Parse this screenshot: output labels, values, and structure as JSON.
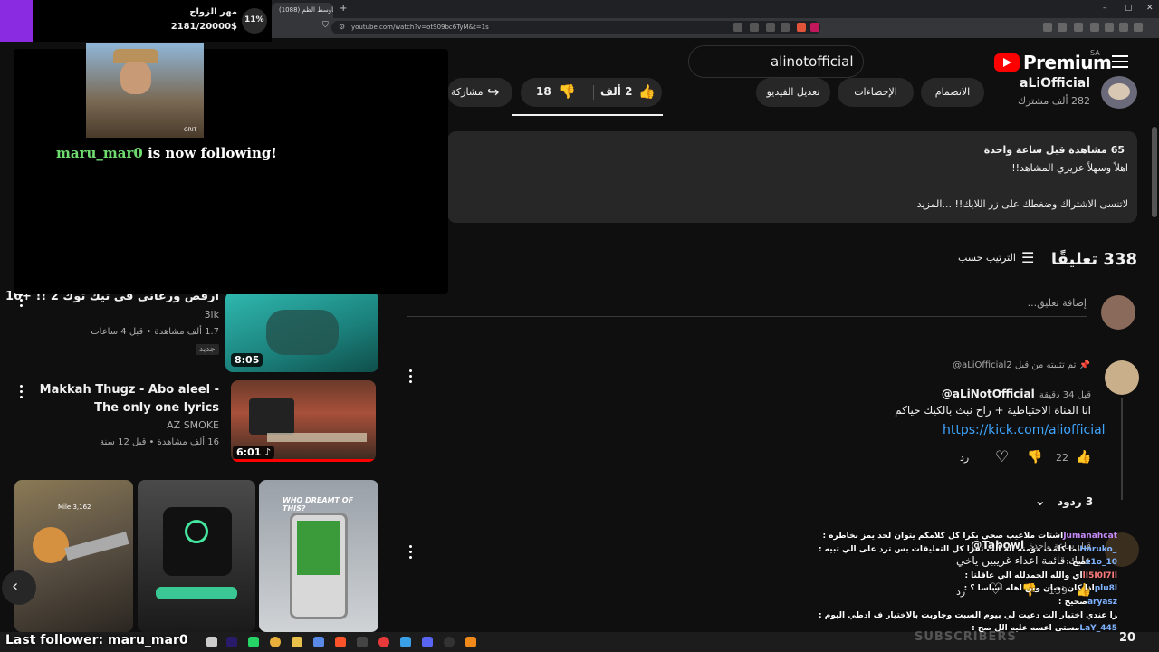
{
  "browser": {
    "tab_title": "(1088) ماوسط الظم...",
    "new_tab_label": "+",
    "url": "youtube.com/watch?v=otS09bc6TyM&t=1s"
  },
  "header": {
    "search_value": "alinotofficial",
    "logo_text": "Premium",
    "region": "SA"
  },
  "channel": {
    "name": "aLiOfficial",
    "subscribers": "282 ألف مشترك",
    "join_label": "الانضمام",
    "stats_label": "الإحصاءات",
    "edit_label": "تعديل الفيديو",
    "like_count": "2 ألف",
    "dislike_count": "18",
    "share_label": "مشاركة"
  },
  "description": {
    "views_time": "65 مشاهدة  قبل ساعة واحدة",
    "line1": "اهلاً وسهلاً عزيزي المشاهد!!",
    "line2": "لاتنسى الاشتراك وضغطك على زر اللايك!! ...المزيد"
  },
  "comments": {
    "count_label": "338 تعليقًا",
    "sort_label": "الترتيب حسب",
    "add_placeholder": "إضافة تعليق...",
    "pinned_by": "تم تثبيته من قبل ‎@aLiOfficial2",
    "items": [
      {
        "author": "@aLiNotOfficial",
        "time": "قبل 34 دقيقة",
        "text": "انا القناة الاحتياطية + راح نبث بالكيك حياكم",
        "link": "https://kick.com/aliofficial",
        "likes": "22",
        "reply_label": "رد",
        "replies_label": "3 ردود"
      },
      {
        "author": "@Tabowi",
        "time": "قبل ساعة واحدة",
        "text": "عليك قائمة اعداء غريبين ياخي",
        "likes": "159",
        "reply_label": "رد"
      }
    ]
  },
  "sidebar": {
    "videos": [
      {
        "title": "ارقص ورعاني في تيك توك 2 !! +16",
        "channel": "3lk",
        "meta": "1.7 ألف مشاهدة • قبل 4 ساعات",
        "badge": "جديد",
        "duration": "8:05"
      },
      {
        "title": "Makkah Thugz - Abo aleel - The only one lyrics",
        "channel": "AZ SMOKE",
        "meta": "16 ألف مشاهدة • قبل 12 سنة",
        "duration": "6:01"
      }
    ],
    "shorts_captions": [
      "Mile 3,162",
      "",
      "WHO DREAMT OF THIS?"
    ]
  },
  "overlay": {
    "goal_title": "مهر الزواج",
    "goal_progress": "2181/20000$",
    "goal_percent": "11%",
    "goal_fraction": 0.11,
    "follow_user": "maru_mar0",
    "follow_text": " is now following!",
    "gif_watermark": "GRIT",
    "last_follower": "Last follower: maru_mar0",
    "subscribers_watermark": "SUBSCRIBERS",
    "sub_count": "20"
  },
  "chat": [
    {
      "user": "Jumanahcat",
      "msg": ": اشتات ملاعيب صحي بكرا كل كلامكم يتوان لحد يمز بخاطره",
      "color": "#c58af9"
    },
    {
      "user": "Haruko_59",
      "msg": ": اما كلمت مؤمنه اله الت تقرا كل التعليقات بس ترد على الي تبيه",
      "color": "#7fb2ff"
    },
    {
      "user": "z1o_10",
      "msg": ": صح",
      "color": "#7fb2ff"
    },
    {
      "user": "lI5I0I7Il",
      "msg": ": اي والله الحمدلله الي عاقلتا",
      "color": "#ff7b7b"
    },
    {
      "user": "plu8l",
      "msg": ": اذا كان تعبان وين أهله اساسا ؟",
      "color": "#7fb2ff"
    },
    {
      "user": "aryasz",
      "msg": ": صحيح",
      "color": "#7fb2ff"
    },
    {
      "user": "xcng",
      "msg": ": على اذطي بكرا عندي اختبار الت دعيت لي بيوم السبت وجاوبت بالاختيار ف ادطي اليوم",
      "color": "#7fb2ff"
    },
    {
      "user": "LaY_445",
      "msg": ": مستى اعسه عليه الل صح",
      "color": "#7fb2ff"
    }
  ],
  "colors": {
    "background": "#0f0f0f",
    "surface": "#272727",
    "link": "#3ea6ff",
    "youtube_red": "#ff0000",
    "follow_green": "#6fdc6f",
    "overlay_purple": "#8a2be2"
  }
}
